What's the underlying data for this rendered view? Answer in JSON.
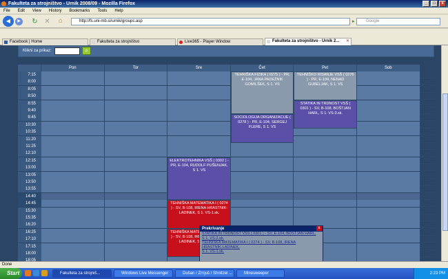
{
  "window": {
    "title": "Fakulteta za strojništvo - Urnik 2008/09 - Mozilla Firefox"
  },
  "menu": [
    "File",
    "Edit",
    "View",
    "History",
    "Bookmarks",
    "Tools",
    "Help"
  ],
  "nav": {
    "url": "http://fs.uni-mb.si/urnik/groups.asp",
    "search_placeholder": "Google"
  },
  "tabs": [
    {
      "label": "Facebook | Home",
      "active": false
    },
    {
      "label": "Fakulteta za strojništvo",
      "active": false
    },
    {
      "label": "Live365 - Player Window",
      "active": false
    },
    {
      "label": "Fakulteta za strojništvo - Urnik 2...",
      "active": true
    }
  ],
  "page": {
    "klik_label": "Klikni za prikaz:",
    "days": [
      "Pon",
      "Tor",
      "Sre",
      "Čet",
      "Pet",
      "Sob"
    ],
    "times": [
      "7:15",
      "8:00",
      "8:05",
      "8:50",
      "8:55",
      "9:40",
      "9:45",
      "10:30",
      "10:35",
      "11:20",
      "11:25",
      "12:10",
      "12:15",
      "13:00",
      "13:05",
      "13:50",
      "13:55",
      "14:40",
      "14:45",
      "15:30",
      "15:35",
      "16:20",
      "16:25",
      "17:10",
      "17:15",
      "18:00",
      "18:05"
    ],
    "events": [
      {
        "day": 3,
        "start": 0,
        "end": 6,
        "color": "gray",
        "text": "TEHNIŠKA FIZIKA ( 0275 ) - PR, E-104, JANA PADEŽNIK GOMILŠEK, S 1. VS"
      },
      {
        "day": 3,
        "start": 6,
        "end": 10,
        "color": "purple",
        "text": "SOCIOLOGIJA ORGANIZACIJE ( 0278 ) - PR, E-104, SERGEJ FLERE, S 1. VS"
      },
      {
        "day": 4,
        "start": 0,
        "end": 4,
        "color": "gray",
        "text": "TEHNIŠKO RISANJE VSŠ ( 0276 ) - PR, E-104, NENAD GUBELJAK, S 1. VS"
      },
      {
        "day": 4,
        "start": 4,
        "end": 8,
        "color": "purple",
        "text": "STATIKA IN TRDNOST VSŠ ( 0301 ) - SV, B-108, BOŠTJAN HARL, S 1. VS-3.sk."
      },
      {
        "day": 2,
        "start": 12,
        "end": 18,
        "color": "purple",
        "text": "ELEKTROTEHNIKA VSŠ ( 0302 ) - PR, E-104, RUDOLF PUŠENJAK, S 1. VS"
      },
      {
        "day": 2,
        "start": 18,
        "end": 22,
        "color": "red",
        "text": "TEHNIŠKA MATEMATIKA I ( 0274 ) - SV, B-108, IRENA HRASTNIK-LADINEK, S 1. VS-1.sk."
      },
      {
        "day": 2,
        "start": 22,
        "end": 26,
        "color": "red",
        "text": "TEHNIŠKA MATEMATIKA I ( 0274 ) - SV, B-108, IRENA HRASTNIK-LADINEK, S 1. VS-1.sk."
      }
    ],
    "popup": {
      "title": "Prekrivanje",
      "lines": [
        "STATIKA IN TRDNOST VSŠ ( 0301 ) - SV, E-104, BOŠTJAN HARL,",
        "S 1. VS-2.sk.",
        "TEHNIŠKA MATEMATIKA I ( 0274 ) - SV, B-108, IRENA",
        "HRASTNIK-LADINEK,",
        "S 1. VS-1.sk."
      ],
      "close": "x"
    }
  },
  "status": "Done",
  "taskbar": {
    "start": "Start",
    "buttons": [
      {
        "label": "Fakulteta za strojniš...",
        "active": true
      },
      {
        "label": "Windows Live Messenger",
        "active": false
      },
      {
        "label": "Dušan / Zrnjuš / Shnitzel ...",
        "active": false
      },
      {
        "label": "Minesweeper",
        "active": false
      }
    ],
    "clock": "2:23 PM"
  }
}
